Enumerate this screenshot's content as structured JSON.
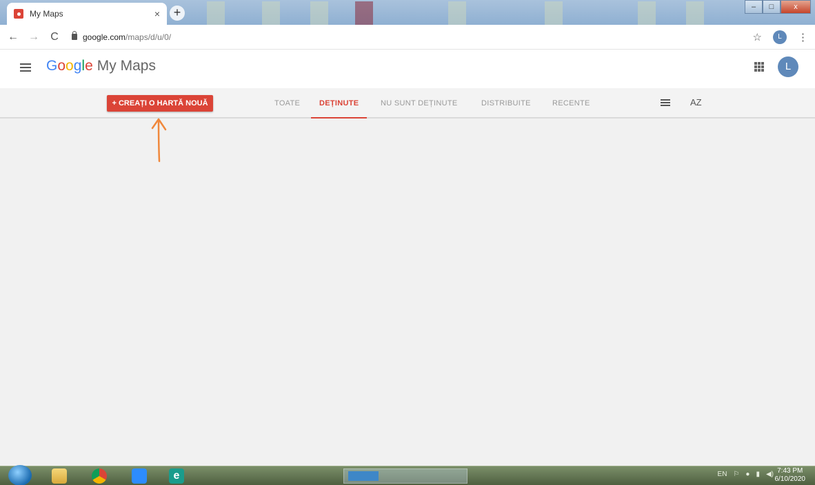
{
  "browser": {
    "tab_title": "My Maps",
    "tab_close": "×",
    "new_tab": "+",
    "url_host": "google.com",
    "url_path": "/maps/d/u/0/",
    "profile_initial": "L"
  },
  "app": {
    "brand_letters": [
      "G",
      "o",
      "o",
      "g",
      "l",
      "e"
    ],
    "product": "My Maps",
    "avatar_initial": "L"
  },
  "filterbar": {
    "create_label": "+ CREAȚI O HARTĂ NOUĂ",
    "tabs": [
      {
        "label": "TOATE",
        "active": false
      },
      {
        "label": "DEȚINUTE",
        "active": true
      },
      {
        "label": "NU SUNT DEȚINUTE",
        "active": false
      },
      {
        "label": "DISTRIBUITE",
        "active": false
      },
      {
        "label": "RECENTE",
        "active": false
      }
    ],
    "sort_label": "AZ"
  },
  "taskbar": {
    "clock_time": "7:43 PM",
    "clock_date": "6/10/2020",
    "lang": "EN"
  },
  "colors": {
    "accent": "#db4437",
    "annotation_arrow": "#f0883c"
  }
}
